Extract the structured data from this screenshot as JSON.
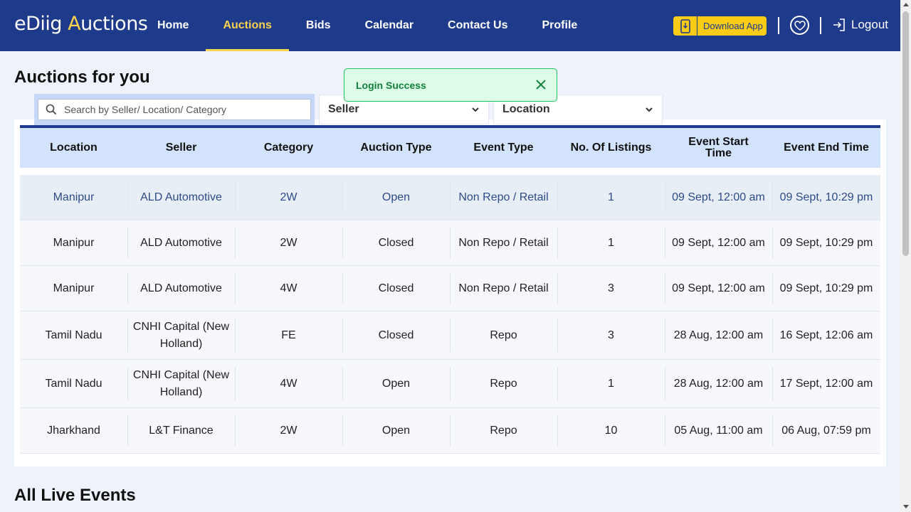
{
  "header": {
    "logo": {
      "prefix": "e",
      "mid": "Diig ",
      "accent": "A",
      "suffix": "uctions"
    },
    "nav": [
      "Home",
      "Auctions",
      "Bids",
      "Calendar",
      "Contact Us",
      "Profile"
    ],
    "active_nav": "Auctions",
    "download_label": "Download App",
    "logout_label": "Logout"
  },
  "toast": {
    "message": "Login Success"
  },
  "main": {
    "title": "Auctions for you",
    "search_placeholder": "Search by Seller/ Location/ Category",
    "seller_select": "Seller",
    "location_select": "Location",
    "columns": [
      "Location",
      "Seller",
      "Category",
      "Auction Type",
      "Event Type",
      "No. Of Listings",
      "Event Start Time",
      "Event End Time"
    ],
    "rows": [
      [
        "Manipur",
        "ALD Automotive",
        "2W",
        "Open",
        "Non Repo / Retail",
        "1",
        "09 Sept, 12:00 am",
        "09 Sept, 10:29 pm"
      ],
      [
        "Manipur",
        "ALD Automotive",
        "2W",
        "Closed",
        "Non Repo / Retail",
        "1",
        "09 Sept, 12:00 am",
        "09 Sept, 10:29 pm"
      ],
      [
        "Manipur",
        "ALD Automotive",
        "4W",
        "Closed",
        "Non Repo / Retail",
        "3",
        "09 Sept, 12:00 am",
        "09 Sept, 10:29 pm"
      ],
      [
        "Tamil Nadu",
        "CNHI Capital (New Holland)",
        "FE",
        "Closed",
        "Repo",
        "3",
        "28 Aug, 12:00 am",
        "16 Sept, 12:06 am"
      ],
      [
        "Tamil Nadu",
        "CNHI Capital (New Holland)",
        "4W",
        "Open",
        "Repo",
        "1",
        "28 Aug, 12:00 am",
        "17 Sept, 12:00 am"
      ],
      [
        "Jharkhand",
        "L&T Finance",
        "2W",
        "Open",
        "Repo",
        "10",
        "05 Aug, 11:00 am",
        "06 Aug, 07:59 pm"
      ]
    ],
    "section2_title": "All Live Events"
  },
  "colors": {
    "header_bg": "#1e3a8a",
    "accent": "#fcd34d",
    "table_header_bg": "#d3e3fd",
    "toast_bg": "#dcfce7",
    "toast_text": "#15803d"
  },
  "icons": [
    "phone-download-icon",
    "heart-icon",
    "logout-icon",
    "search-icon",
    "chevron-down-icon",
    "close-icon"
  ]
}
